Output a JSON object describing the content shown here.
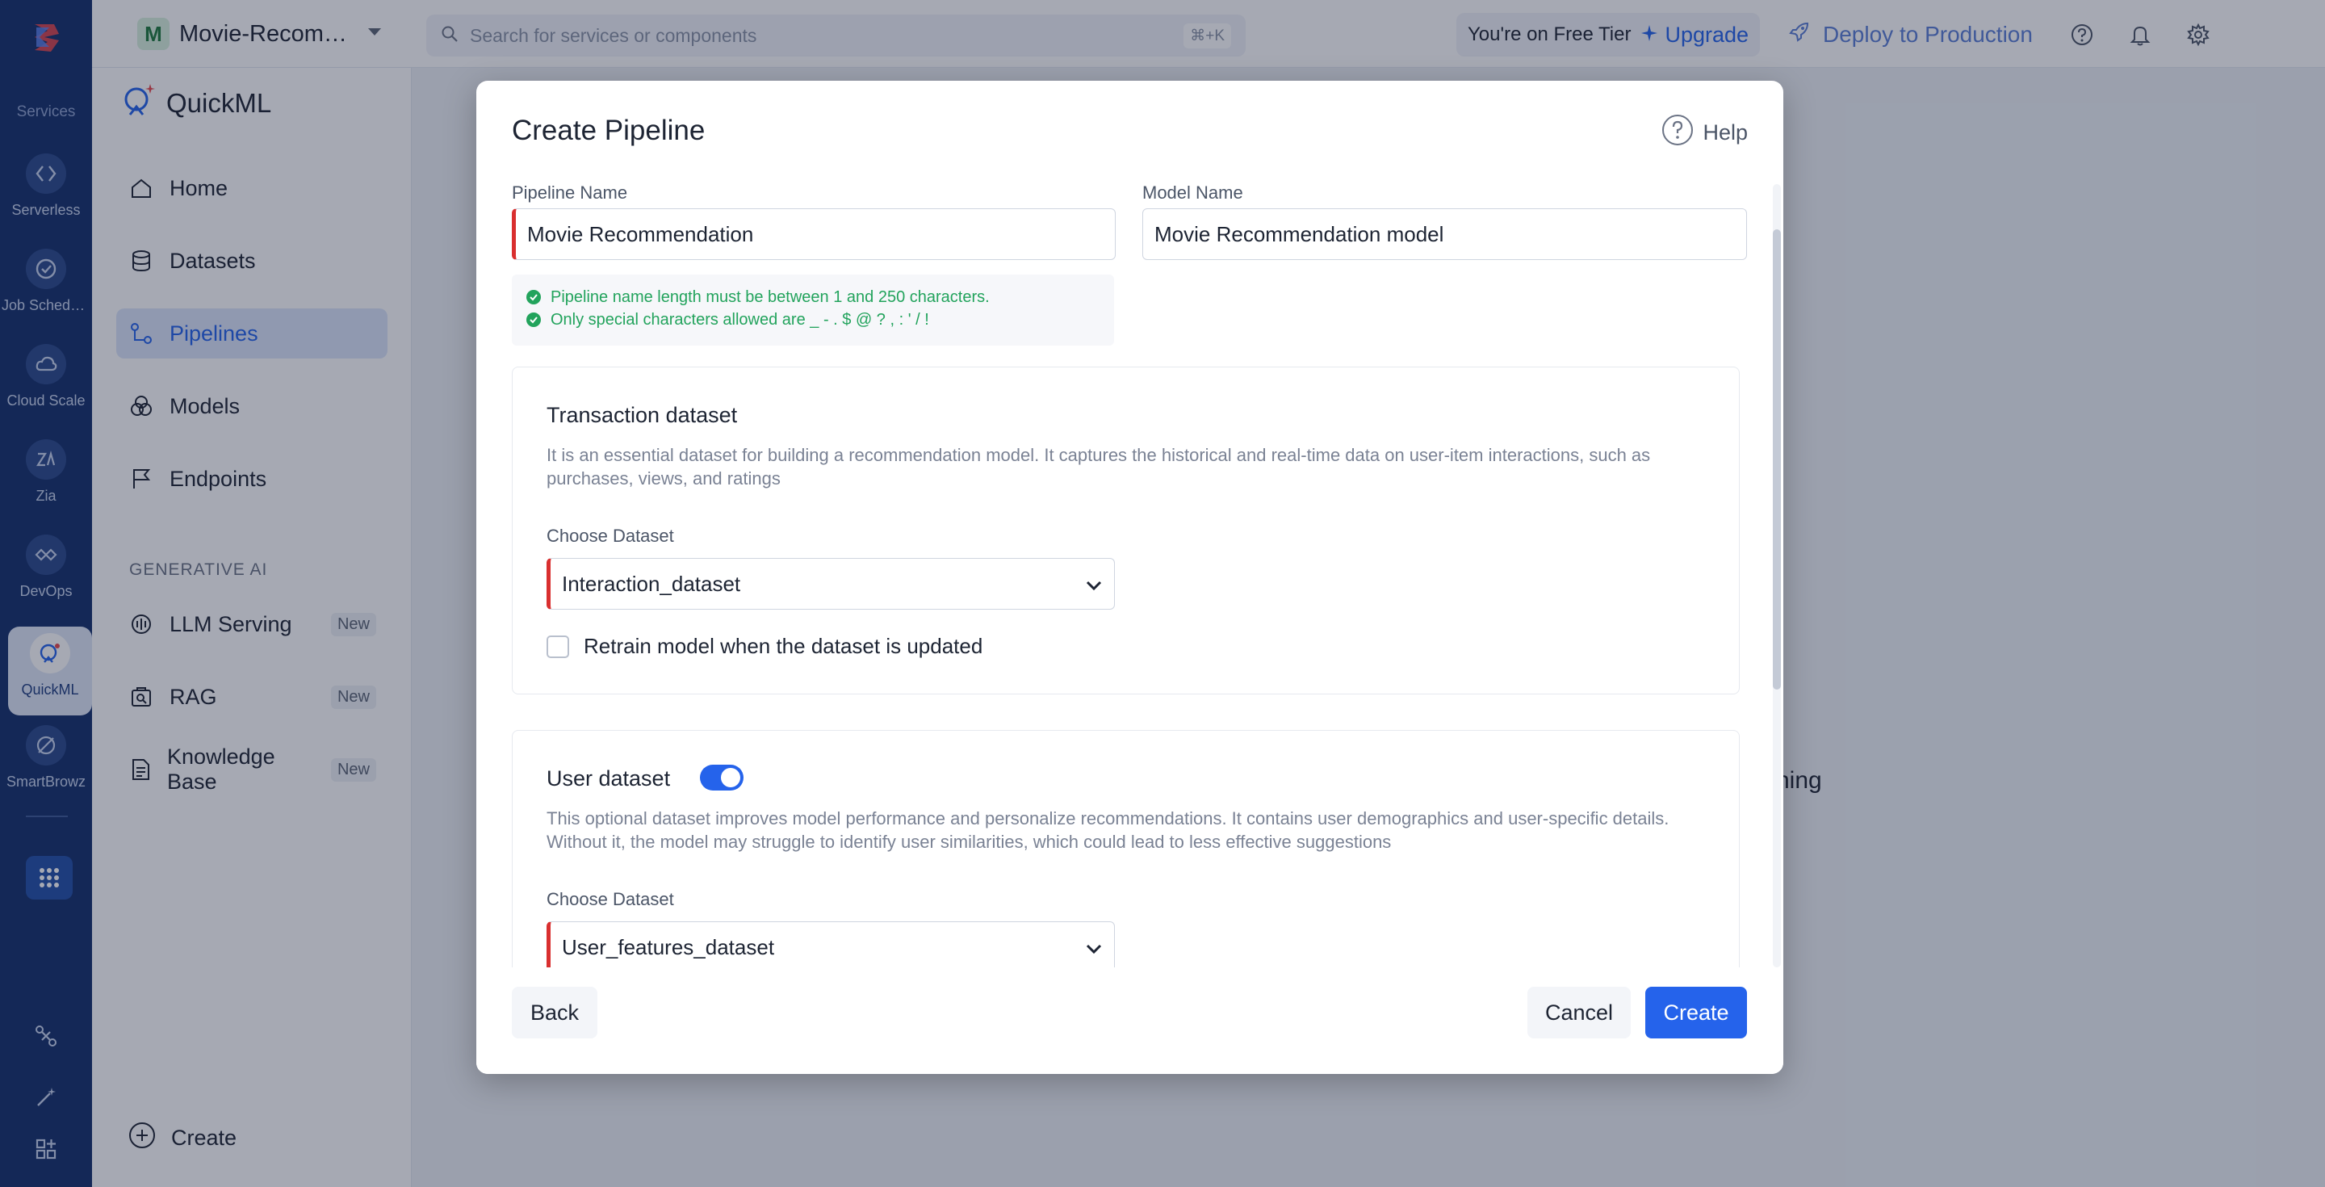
{
  "rail": {
    "section_label": "Services",
    "items": [
      {
        "label": "Serverless",
        "icon": "serverless-icon"
      },
      {
        "label": "Job Scheduling",
        "icon": "job-scheduling-icon"
      },
      {
        "label": "Cloud Scale",
        "icon": "cloud-scale-icon"
      },
      {
        "label": "Zia",
        "icon": "zia-icon"
      },
      {
        "label": "DevOps",
        "icon": "devops-icon"
      },
      {
        "label": "QuickML",
        "icon": "quickml-icon"
      },
      {
        "label": "SmartBrowz",
        "icon": "smartbrowz-icon"
      }
    ]
  },
  "topbar": {
    "project_initial": "M",
    "project_name": "Movie-Recommendation",
    "search_placeholder": "Search for services or components",
    "search_shortcut": "⌘+K",
    "tier_text": "You're on Free Tier",
    "upgrade_label": "Upgrade",
    "deploy_label": "Deploy to Production"
  },
  "sidenav": {
    "brand": "QuickML",
    "items": [
      {
        "label": "Home"
      },
      {
        "label": "Datasets"
      },
      {
        "label": "Pipelines",
        "active": true
      },
      {
        "label": "Models"
      },
      {
        "label": "Endpoints"
      }
    ],
    "section_label": "GENERATIVE AI",
    "gen_items": [
      {
        "label": "LLM Serving",
        "badge": "New"
      },
      {
        "label": "RAG",
        "badge": "New"
      },
      {
        "label": "Knowledge Base",
        "badge": "New"
      }
    ],
    "create_label": "Create"
  },
  "background_text": "rning",
  "modal": {
    "title": "Create Pipeline",
    "help_label": "Help",
    "pipeline_name_label": "Pipeline Name",
    "pipeline_name_value": "Movie Recommendation",
    "model_name_label": "Model Name",
    "model_name_value": "Movie Recommendation model",
    "hints": [
      "Pipeline name length must be between 1 and 250 characters.",
      "Only special characters allowed are _ - . $ @ ? , : ' / !"
    ],
    "transaction": {
      "title": "Transaction dataset",
      "description": "It is an essential dataset for building a recommendation model. It captures the historical and real-time data on user-item interactions, such as purchases, views, and ratings",
      "choose_label": "Choose Dataset",
      "selected": "Interaction_dataset",
      "retrain_label": "Retrain model when the dataset is updated",
      "retrain_checked": false
    },
    "user": {
      "title": "User dataset",
      "toggle_on": true,
      "description": "This optional dataset improves model performance and personalize recommendations. It contains user demographics and user-specific details. Without it, the model may struggle to identify user similarities, which could lead to less effective suggestions",
      "choose_label": "Choose Dataset",
      "selected": "User_features_dataset"
    },
    "back_label": "Back",
    "cancel_label": "Cancel",
    "create_label": "Create"
  },
  "colors": {
    "accent": "#2563eb",
    "rail_bg": "#14306b",
    "required": "#d92f2f",
    "success": "#22a35c"
  }
}
